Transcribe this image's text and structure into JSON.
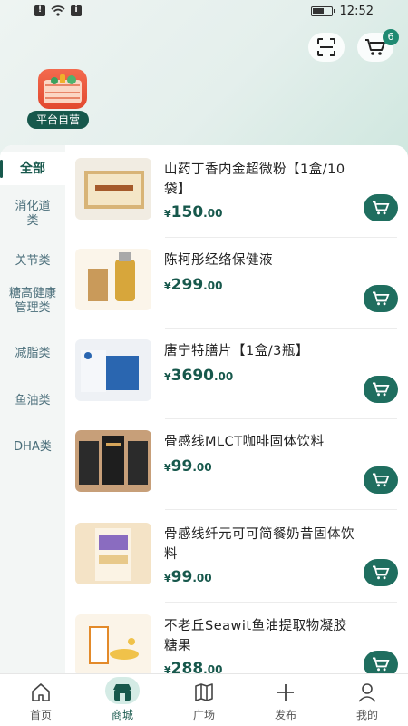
{
  "status_bar": {
    "time": "12:52"
  },
  "header": {
    "cart_badge": "6",
    "store_tag": "平台自营",
    "icons": [
      "scan-icon",
      "cart-icon"
    ]
  },
  "sidebar": {
    "items": [
      {
        "label": "全部",
        "active": true
      },
      {
        "label": "消化道类"
      },
      {
        "label": "关节类"
      },
      {
        "label": "糖高健康管理类"
      },
      {
        "label": "减脂类"
      },
      {
        "label": "鱼油类"
      },
      {
        "label": "DHA类"
      }
    ]
  },
  "products": [
    {
      "name": "山药丁香内金超微粉【1盒/10袋】",
      "price_yen": "¥",
      "price_int": "150",
      "price_dec": ".00"
    },
    {
      "name": "陈柯彤经络保健液",
      "price_yen": "¥",
      "price_int": "299",
      "price_dec": ".00"
    },
    {
      "name": "唐宁特膳片【1盒/3瓶】",
      "price_yen": "¥",
      "price_int": "3690",
      "price_dec": ".00"
    },
    {
      "name": "骨感线MLCT咖啡固体饮料",
      "price_yen": "¥",
      "price_int": "99",
      "price_dec": ".00"
    },
    {
      "name": "骨感线纤元可可简餐奶昔固体饮料",
      "price_yen": "¥",
      "price_int": "99",
      "price_dec": ".00"
    },
    {
      "name": "不老丘Seawit鱼油提取物凝胶糖果",
      "price_yen": "¥",
      "price_int": "288",
      "price_dec": ".00"
    }
  ],
  "tabbar": {
    "items": [
      {
        "label": "首页",
        "icon": "home-icon"
      },
      {
        "label": "商城",
        "icon": "shop-icon",
        "active": true
      },
      {
        "label": "广场",
        "icon": "map-icon"
      },
      {
        "label": "发布",
        "icon": "plus-icon"
      },
      {
        "label": "我的",
        "icon": "user-icon"
      }
    ]
  },
  "colors": {
    "accent": "#17584c",
    "button": "#1f6e5f",
    "tab_active_bg": "#d4ebe5"
  }
}
